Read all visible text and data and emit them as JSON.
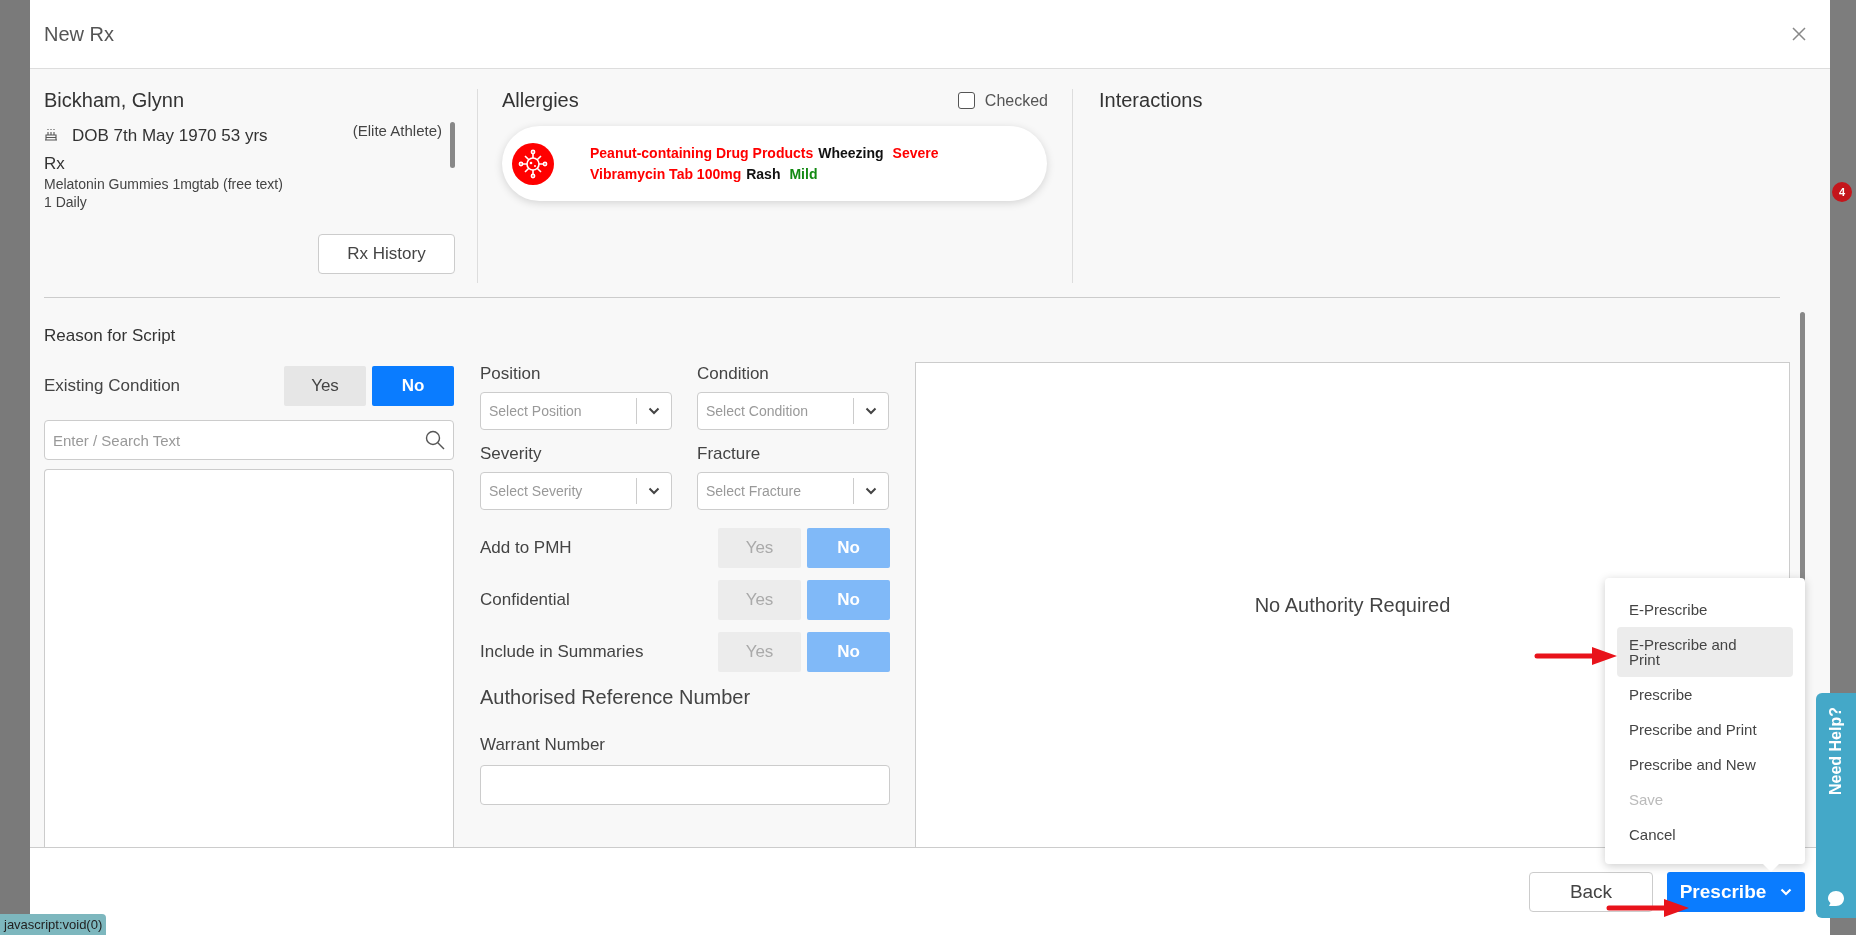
{
  "window": {
    "title": "New Rx"
  },
  "patient": {
    "name": "Bickham, Glynn",
    "dob": "DOB 7th May 1970 53 yrs",
    "tag": "(Elite Athlete)",
    "rx_heading": "Rx",
    "medication": "Melatonin Gummies 1mgtab (free text)",
    "dose": "1 Daily",
    "history_button": "Rx History"
  },
  "allergies": {
    "title": "Allergies",
    "checked_label": "Checked",
    "checked": false,
    "items": [
      {
        "substance": "Peanut-containing Drug Products",
        "reaction": "Wheezing",
        "severity": "Severe",
        "color": "#ff0000"
      },
      {
        "substance": "Vibramycin Tab 100mg",
        "reaction": "Rash",
        "severity": "Mild",
        "color": "#138a13"
      }
    ]
  },
  "interactions": {
    "title": "Interactions"
  },
  "reason": {
    "title": "Reason for Script",
    "existing_condition": {
      "label": "Existing Condition",
      "disabled": false,
      "options": [
        {
          "label": "Yes",
          "selected": false
        },
        {
          "label": "No",
          "selected": true
        }
      ]
    },
    "search": {
      "placeholder": "Enter / Search Text"
    }
  },
  "selects": [
    {
      "label": "Position",
      "placeholder": "Select Position"
    },
    {
      "label": "Condition",
      "placeholder": "Select Condition"
    },
    {
      "label": "Severity",
      "placeholder": "Select Severity"
    },
    {
      "label": "Fracture",
      "placeholder": "Select Fracture"
    }
  ],
  "toggles": [
    {
      "label": "Add to PMH",
      "disabled": true,
      "options": [
        {
          "label": "Yes",
          "selected": false
        },
        {
          "label": "No",
          "selected": true
        }
      ]
    },
    {
      "label": "Confidential",
      "disabled": true,
      "options": [
        {
          "label": "Yes",
          "selected": false
        },
        {
          "label": "No",
          "selected": true
        }
      ]
    },
    {
      "label": "Include in Summaries",
      "disabled": true,
      "options": [
        {
          "label": "Yes",
          "selected": false
        },
        {
          "label": "No",
          "selected": true
        }
      ]
    }
  ],
  "authorised_reference": {
    "title": "Authorised Reference Number",
    "warrant_label": "Warrant Number"
  },
  "authority": {
    "message": "No Authority Required"
  },
  "footer": {
    "back": "Back",
    "prescribe": "Prescribe"
  },
  "menu": {
    "items": [
      {
        "label": "E-Prescribe",
        "highlighted": false,
        "disabled": false
      },
      {
        "label": "E-Prescribe and Print",
        "highlighted": true,
        "disabled": false
      },
      {
        "label": "Prescribe",
        "highlighted": false,
        "disabled": false
      },
      {
        "label": "Prescribe and Print",
        "highlighted": false,
        "disabled": false
      },
      {
        "label": "Prescribe and New",
        "highlighted": false,
        "disabled": false
      },
      {
        "label": "Save",
        "highlighted": false,
        "disabled": true
      },
      {
        "label": "Cancel",
        "highlighted": false,
        "disabled": false
      }
    ]
  },
  "help_tab": {
    "label": "Need Help?"
  },
  "notification_badge": "4",
  "status_link": "javascript:void(0)"
}
